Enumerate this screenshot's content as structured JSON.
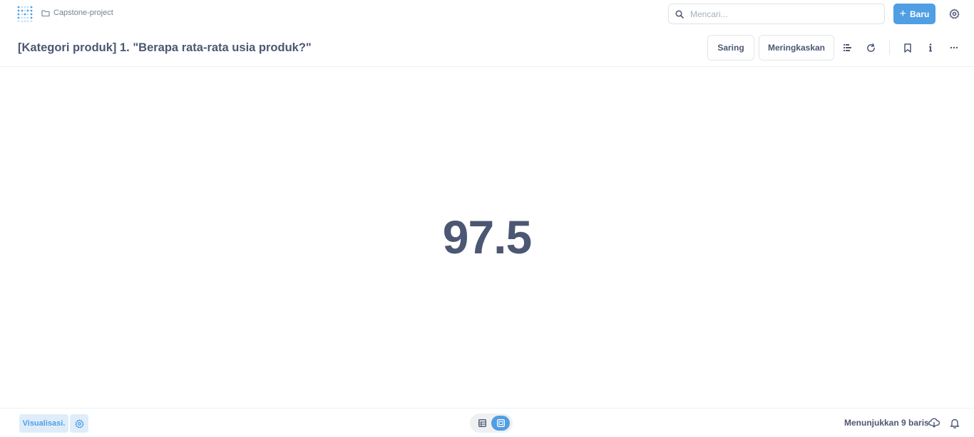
{
  "topbar": {
    "logo_icon": "metabase-logo-icon",
    "breadcrumb": {
      "icon": "folder-icon",
      "label": "Capstone-project"
    },
    "search": {
      "icon": "search-icon",
      "placeholder": "Mencari..."
    },
    "new_button": {
      "icon": "plus-icon",
      "label": "Baru"
    },
    "settings_icon": "gear-icon"
  },
  "header": {
    "title": "[Kategori produk] 1. \"Berapa rata-rata usia produk?\"",
    "filter_label": "Saring",
    "summarize_label": "Meringkaskan",
    "icons": [
      "notebook-icon",
      "refresh-icon",
      "bookmark-icon",
      "info-icon",
      "more-icon"
    ]
  },
  "result": {
    "value": "97.5"
  },
  "footer": {
    "visualization_label": "Visualisasi.",
    "settings_icon": "gear-icon",
    "view_toggle": {
      "left_icon": "table-icon",
      "right_icon": "visualization-icon",
      "active": "right"
    },
    "row_count": "Menunjukkan 9 baris",
    "download_icon": "download-icon",
    "alert_icon": "bell-icon"
  },
  "colors": {
    "brand": "#509ee3",
    "text": "#4c5773",
    "muted": "#74838f"
  }
}
